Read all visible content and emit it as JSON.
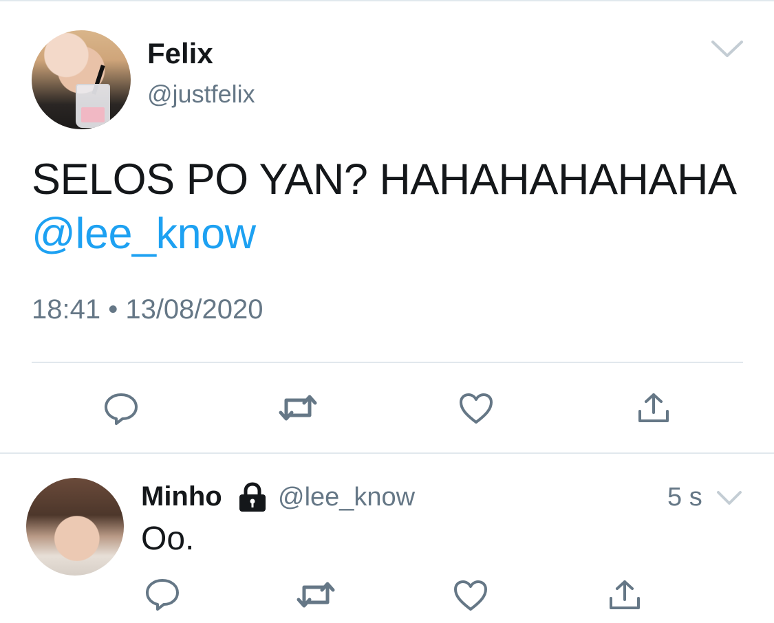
{
  "tweet": {
    "author_name": "Felix",
    "author_handle": "@justfelix",
    "text_line": "SELOS PO YAN? HAHAHAHAHAHA",
    "mention": "@lee_know",
    "timestamp": "18:41 • 13/08/2020",
    "avatar_icon": "avatar",
    "menu_icon": "chevron-down-icon",
    "actions": [
      "reply-icon",
      "retweet-icon",
      "like-icon",
      "share-icon"
    ]
  },
  "reply": {
    "author_name": "Minho",
    "author_handle": "@lee_know",
    "protected_icon": "lock-icon",
    "time_ago": "5 s",
    "text": "Oo.",
    "menu_icon": "chevron-down-icon",
    "actions": [
      "reply-icon",
      "retweet-icon",
      "like-icon",
      "share-icon"
    ]
  },
  "colors": {
    "text": "#14171a",
    "secondary": "#657786",
    "mention": "#1da1f2",
    "divider": "#e1e8ed",
    "icon": "#657786"
  }
}
